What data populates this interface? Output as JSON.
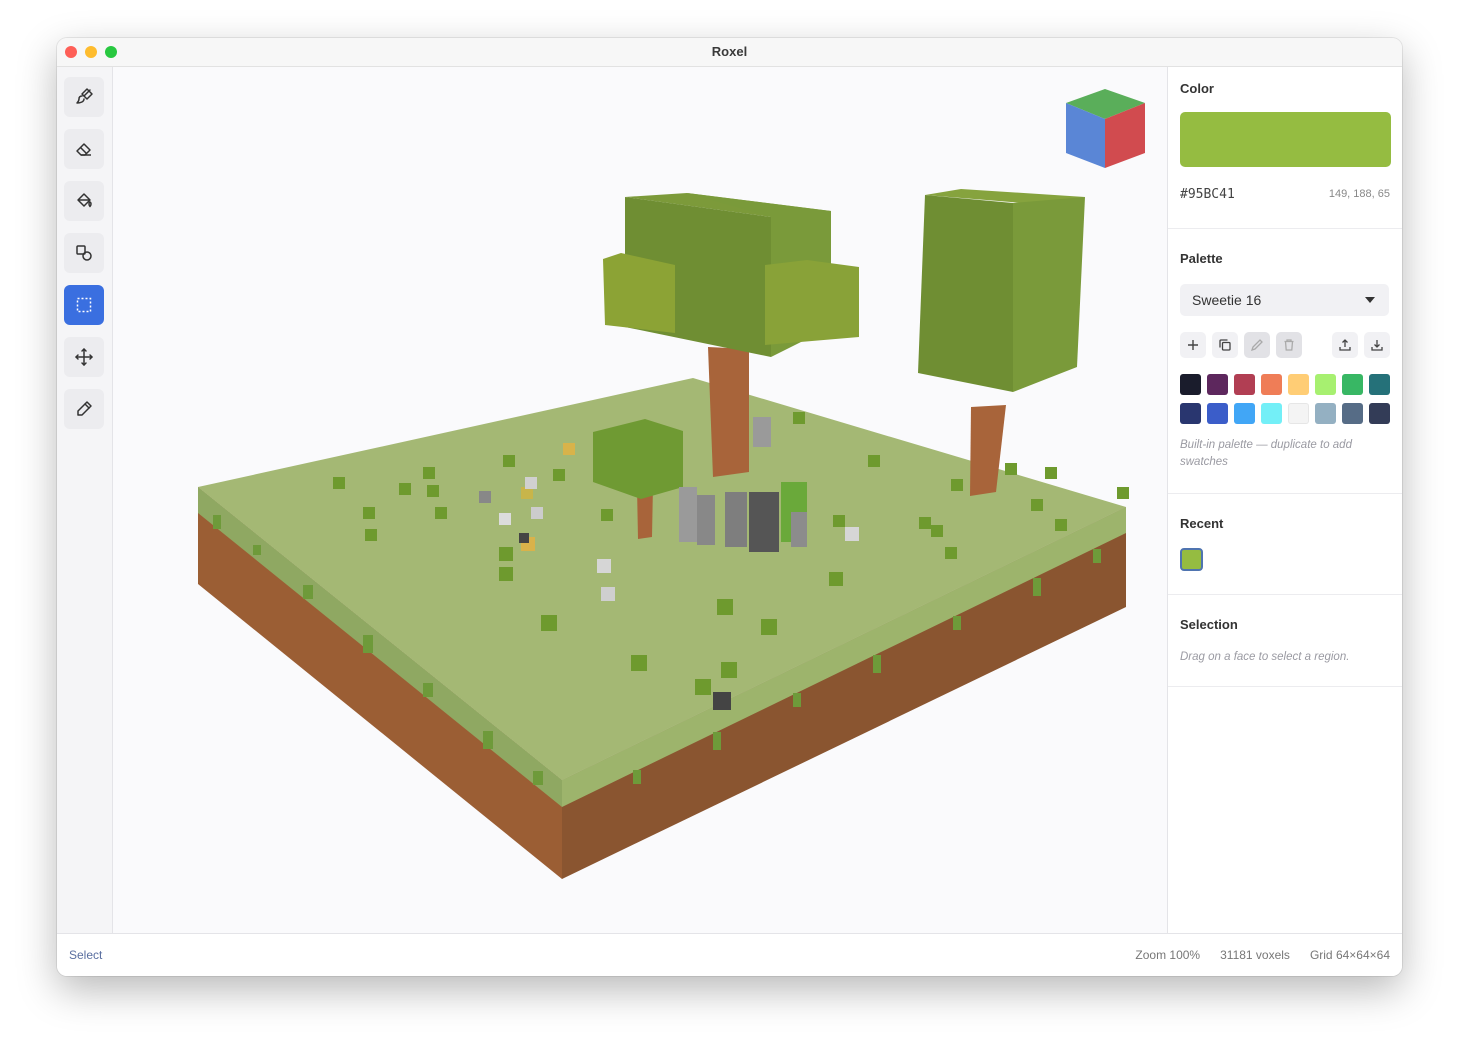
{
  "window": {
    "title": "Roxel"
  },
  "tools": [
    {
      "name": "brush-tool",
      "icon": "paint-brush-icon",
      "active": false
    },
    {
      "name": "eraser-tool",
      "icon": "eraser-icon",
      "active": false
    },
    {
      "name": "fill-tool",
      "icon": "paint-bucket-icon",
      "active": false
    },
    {
      "name": "shapes-tool",
      "icon": "shapes-icon",
      "active": false
    },
    {
      "name": "select-tool",
      "icon": "dashed-selection-icon",
      "active": true
    },
    {
      "name": "move-tool",
      "icon": "move-arrows-icon",
      "active": false
    },
    {
      "name": "eyedropper-tool",
      "icon": "eyedropper-icon",
      "active": false
    }
  ],
  "panel": {
    "color": {
      "title": "Color",
      "hex": "#95BC41",
      "rgb": "149, 188, 65",
      "swatch_color": "#95bc41"
    },
    "palette": {
      "title": "Palette",
      "selected": "Sweetie 16",
      "actions": [
        {
          "name": "add-swatch-button",
          "icon": "plus-icon",
          "enabled": true
        },
        {
          "name": "duplicate-palette-button",
          "icon": "duplicate-icon",
          "enabled": true
        },
        {
          "name": "edit-palette-button",
          "icon": "pencil-icon",
          "enabled": false
        },
        {
          "name": "delete-palette-button",
          "icon": "trash-icon",
          "enabled": false
        },
        {
          "name": "export-palette-button",
          "icon": "upload-icon",
          "enabled": true
        },
        {
          "name": "import-palette-button",
          "icon": "download-icon",
          "enabled": true
        }
      ],
      "swatches": [
        "#1a1c2c",
        "#5d275d",
        "#b13e53",
        "#ef7d57",
        "#ffcd75",
        "#a7f070",
        "#38b764",
        "#257179",
        "#29366f",
        "#3b5dc9",
        "#41a6f6",
        "#73eff7",
        "#f4f4f4",
        "#94b0c2",
        "#566c86",
        "#333c57"
      ],
      "hint": "Built-in palette — duplicate to add swatches"
    },
    "recent": {
      "title": "Recent",
      "swatches": [
        "#95bc41"
      ]
    },
    "selection": {
      "title": "Selection",
      "hint": "Drag on a face to select a region."
    }
  },
  "status": {
    "mode": "Select",
    "zoom": "Zoom 100%",
    "voxels": "31181 voxels",
    "grid": "Grid 64×64×64"
  },
  "viewport": {
    "gizmo": {
      "top_color": "#5aae5a",
      "left_color": "#5a86d6",
      "right_color": "#d14b4f"
    }
  }
}
